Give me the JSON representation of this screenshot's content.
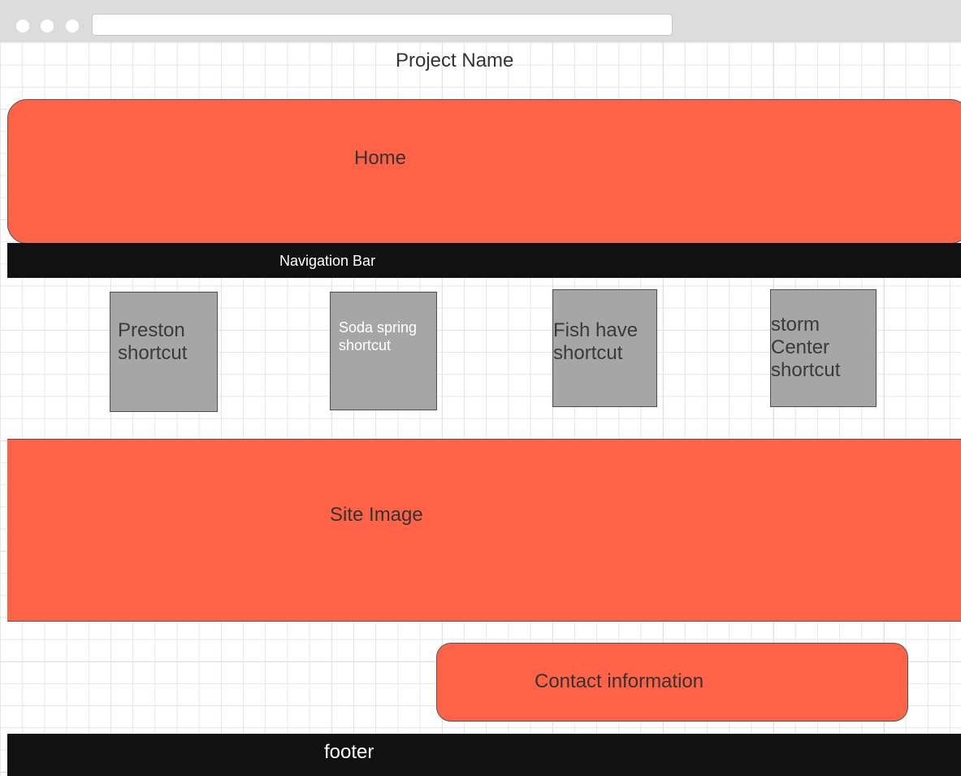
{
  "project_name": "Project Name",
  "home": "Home",
  "navigation_bar": "Navigation Bar",
  "shortcuts": [
    {
      "label": "Preston\nshortcut"
    },
    {
      "label": "Soda spring\nshortcut"
    },
    {
      "label": "Fish have\nshortcut"
    },
    {
      "label": "storm\nCenter\nshortcut"
    }
  ],
  "site_image": "Site Image",
  "contact_information": "Contact information",
  "footer": "footer",
  "colors": {
    "accent": "#ff6347",
    "bar": "#111111",
    "shortcut": "#a6a6a6",
    "chrome": "#dcdcdc"
  }
}
